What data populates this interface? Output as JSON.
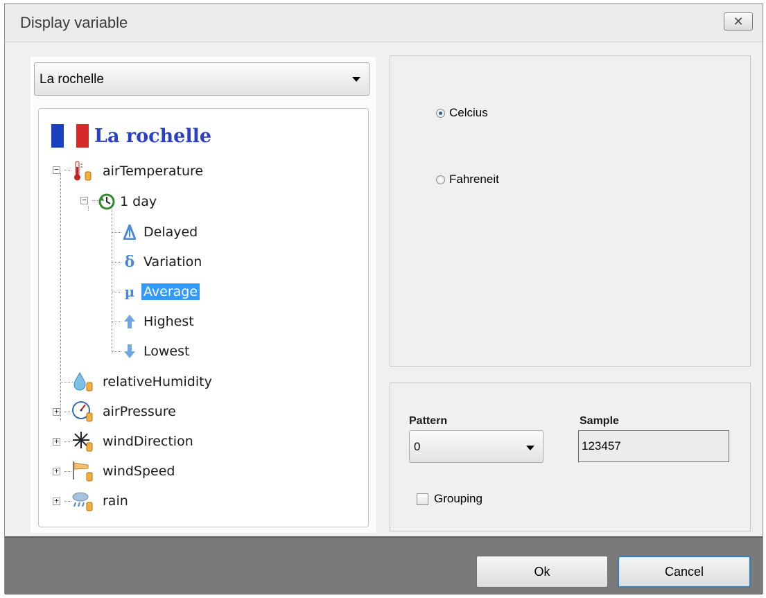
{
  "window": {
    "title": "Display variable",
    "close_icon": "close-icon"
  },
  "station_select": {
    "selected": "La rochelle"
  },
  "tree": {
    "station": {
      "name": "La rochelle",
      "icon": "france-flag-icon"
    },
    "air_temperature": {
      "label": "airTemperature",
      "icon": "thermometer-icon",
      "period": {
        "label": "1 day",
        "icon": "clock-refresh-icon",
        "items": [
          {
            "label": "Delayed",
            "icon": "delayed-icon"
          },
          {
            "label": "Variation",
            "icon": "variation-icon"
          },
          {
            "label": "Average",
            "icon": "average-icon",
            "selected": true
          },
          {
            "label": "Highest",
            "icon": "arrow-up-icon"
          },
          {
            "label": "Lowest",
            "icon": "arrow-down-icon"
          }
        ]
      }
    },
    "other_variables": [
      {
        "label": "relativeHumidity",
        "icon": "humidity-drop-icon",
        "expandable": false
      },
      {
        "label": "airPressure",
        "icon": "barometer-icon",
        "expandable": true
      },
      {
        "label": "windDirection",
        "icon": "wind-rose-icon",
        "expandable": true
      },
      {
        "label": "windSpeed",
        "icon": "windsock-icon",
        "expandable": true
      },
      {
        "label": "rain",
        "icon": "rain-cloud-icon",
        "expandable": true
      }
    ]
  },
  "units": {
    "options": [
      {
        "label": "Celcius",
        "selected": true
      },
      {
        "label": "Fahreneit",
        "selected": false
      }
    ]
  },
  "format": {
    "pattern_label": "Pattern",
    "pattern_value": "0",
    "sample_label": "Sample",
    "sample_value": "123457",
    "grouping_label": "Grouping",
    "grouping_checked": false
  },
  "buttons": {
    "ok": "Ok",
    "cancel": "Cancel"
  },
  "colors": {
    "selection": "#3399ff",
    "station_name": "#2a40c8",
    "footer": "#7a7a7a"
  }
}
